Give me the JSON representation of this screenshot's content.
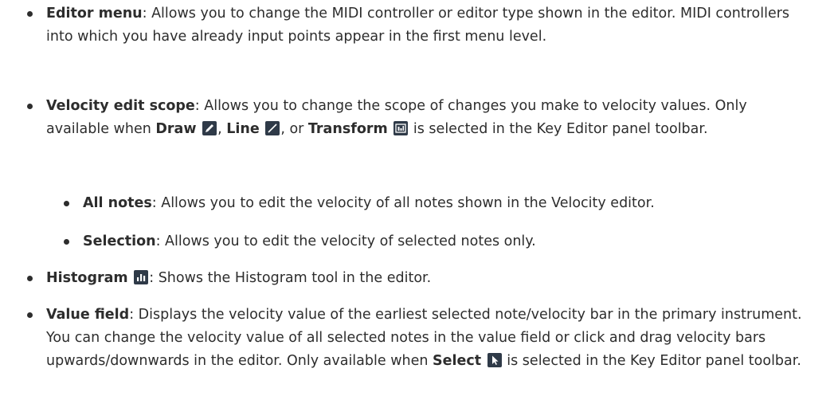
{
  "items": [
    {
      "term": "Editor menu",
      "text": ": Allows you to change the MIDI controller or editor type shown in the editor. MIDI controllers into which you have already input points appear in the first menu level."
    },
    {
      "term": "Velocity edit scope",
      "text_a": ": Allows you to change the scope of changes you make to velocity values. Only available when ",
      "draw": "Draw",
      "sep1": ", ",
      "line": "Line",
      "sep2": ", or ",
      "transform": "Transform",
      "text_b": " is selected in the Key Editor panel toolbar."
    },
    {
      "term": "All notes",
      "text": ": Allows you to edit the velocity of all notes shown in the Velocity editor."
    },
    {
      "term": "Selection",
      "text": ": Allows you to edit the velocity of selected notes only."
    },
    {
      "term": "Histogram",
      "text": ": Shows the Histogram tool in the editor."
    },
    {
      "term": "Value field",
      "text_a": ": Displays the velocity value of the earliest selected note/velocity bar in the primary instrument. You can change the velocity value of all selected notes in the value field or click and drag velocity bars upwards/downwards in the editor. Only available when ",
      "select": "Select",
      "text_b": " is selected in the Key Editor panel toolbar."
    }
  ],
  "icons": [
    "pencil-icon",
    "line-icon",
    "transform-icon",
    "histogram-icon",
    "select-cursor-icon"
  ]
}
